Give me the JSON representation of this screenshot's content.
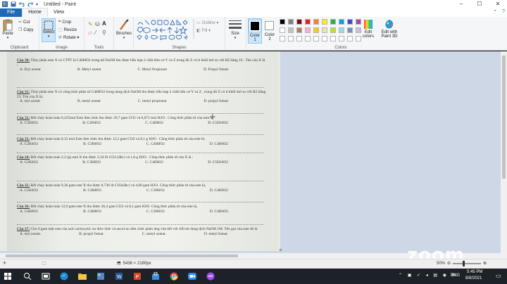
{
  "window": {
    "title": "Untitled - Paint",
    "controls": [
      "–",
      "☐",
      "✕"
    ]
  },
  "menu": {
    "file": "File",
    "home": "Home",
    "view": "View"
  },
  "ribbon": {
    "clipboard": {
      "label": "Clipboard",
      "paste": "Paste",
      "cut": "Cut",
      "copy": "Copy"
    },
    "image": {
      "label": "Image",
      "select": "Select",
      "crop": "Crop",
      "resize": "Resize",
      "rotate": "Rotate ▾"
    },
    "tools": {
      "label": "Tools"
    },
    "brushes": "Brushes",
    "shapes": {
      "label": "Shapes",
      "outline": "Outline ▾",
      "fill": "Fill ▾"
    },
    "size": "Size",
    "color1": "Color 1",
    "color2": "Color 2",
    "colors": {
      "label": "Colors",
      "palette": [
        "#000000",
        "#7f7f7f",
        "#880015",
        "#ed1c24",
        "#ff7f27",
        "#fff200",
        "#22b14c",
        "#00a2e8",
        "#3f48cc",
        "#a349a4",
        "#ffffff",
        "#c3c3c3",
        "#b97a57",
        "#ffaec9",
        "#ffc90e",
        "#efe4b0",
        "#b5e61d",
        "#99d9ea",
        "#7092be",
        "#c8bfe7"
      ]
    },
    "edit_colors": "Edit colors",
    "edit_paint3d": "Edit with Paint 3D"
  },
  "document": {
    "questions": [
      {
        "num": "Câu 30:",
        "text": "Thủy phân este X có CTPT là C4H8O2 trong dd NaOH thu được hỗn hợp 2 chất hữu cơ Y và Z trong đó Z có tỉ khối hơi so với H2 bằng 16 . Tên của X là :",
        "opts": [
          "A. Etyl axetat",
          "B. Metyl axetat",
          "C. Metyl Propionat",
          "D. Propyl fomat"
        ]
      },
      {
        "num": "Câu 31:",
        "text": "Thủy phân este X có công thức phân tử C4H8O2 trong dung dịch NaOH thu được hỗn hợp 2 chất hữu cơ Y và Z , trong đó Z có tỉ khối hơi so với H2 bằng 23. Tên của X là:",
        "opts": [
          "A. etyl axetat",
          "B. metyl axetat",
          "C. metyl propionat",
          "D. propyl fomat"
        ]
      },
      {
        "num": "Câu 32:",
        "text": "Đốt cháy hoàn toàn 0,225mol Este đơn chức thu được 29,7 gam CO2 và 0,675 mol H2O . Công thức phân tử của este là:",
        "opts": [
          "A. C3H6O2",
          "B. C2H4O2",
          "C. C4H8O2",
          "D. C5H10O2"
        ]
      },
      {
        "num": "Câu 33:",
        "text": "Đốt cháy hoàn toàn 0,15 mol Este đơn chức thu được 13,2 gam CO2 và 8,1 g H2O . Công thức phân tử của este là:",
        "opts": [
          "A. C2H4O2",
          "B. C3H6O2",
          "C. C4H8O2",
          "D. C4H6O2"
        ]
      },
      {
        "num": "Câu 34:",
        "text": "Đốt cháy hoàn toàn 2,2 (g) este X thu được 2,24 lít CO2 (đkc) và 1,8 g H2O . Công thức phân tử của X là :",
        "opts": [
          "A. C2H4O2",
          "B. C3H6O2",
          "C. C4H8O2",
          "D. C5H10O2"
        ]
      },
      {
        "num": "Câu 35:",
        "text": "Đốt cháy hoàn toàn 9,36 gam este X thu được 8.736 lít CO2(đkc) và 4,68 gam H2O. Công thức phân tử của este là,",
        "opts": [
          "A. C2H4O2",
          "B. C4H8O2",
          "C. C3H6O2",
          "D. C4H6O2"
        ]
      },
      {
        "num": "Câu 36:",
        "text": "Đốt cháy hoàn toàn 12,9 gam este X thu được 26,4 gam CO2 và 8,1 gam H2O. Công thức phân tử của este là,",
        "opts": [
          "A. C4H6O2",
          "B. C4H8O2",
          "C. C3H6O2",
          "D. C4H4O2"
        ]
      },
      {
        "num": "Câu 37:",
        "text": "Cho 6 gam một este của axit cacboxylic no đơn chức và ancol no đơn chức phản ứng vừa hết với 100 ml dung dịch NaOH 1M. Tên gọi của este đó là",
        "opts": [
          "A. etyl axetat.",
          "B. propyl fomat.",
          "C. metyl axetat.",
          "D. metyl fomat."
        ]
      }
    ]
  },
  "status": {
    "dimensions": "5436 × 2180px",
    "zoom": "50%"
  },
  "overlay": {
    "zoom_logo": "zoom"
  },
  "taskbar": {
    "lang": "ENG",
    "time": "5:45 PM",
    "date": "8/8/2021"
  }
}
